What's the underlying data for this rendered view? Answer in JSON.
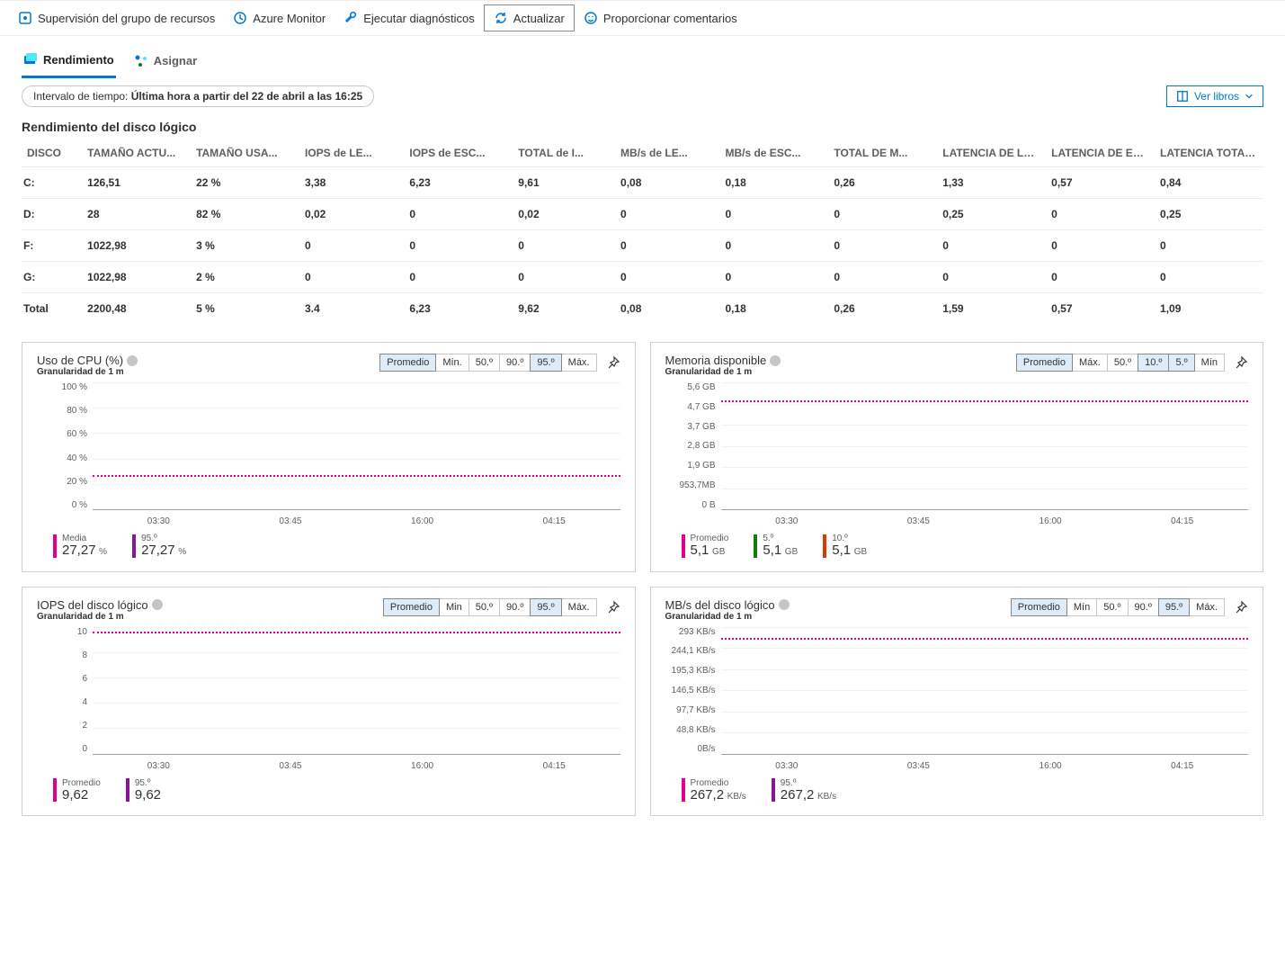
{
  "toolbar": {
    "resource_group": "Supervisión del grupo de recursos",
    "monitor": "Azure Monitor",
    "diagnostics": "Ejecutar diagnósticos",
    "refresh": "Actualizar",
    "feedback": "Proporcionar comentarios"
  },
  "tabs": {
    "performance": "Rendimiento",
    "assign": "Asignar"
  },
  "timerange": {
    "prefix": "Intervalo de tiempo: ",
    "value": "Última hora a partir del 22 de abril a las 16:25"
  },
  "view_books": "Ver libros",
  "section": {
    "title": "Rendimiento del disco lógico"
  },
  "table": {
    "headers": [
      "DISCO",
      "TAMAÑO ACTU...",
      "TAMAÑO USA...",
      "IOPS de LE...",
      "IOPS de ESC...",
      "TOTAL de I...",
      "MB/s de LE...",
      "MB/s de ESC...",
      "TOTAL DE M...",
      "LATENCIA DE LECT...",
      "LATENCIA DE ESCRI...",
      "LATENCIA TOTAL de..."
    ],
    "rows": [
      [
        "C:",
        "126,51",
        "22 %",
        "3,38",
        "6,23",
        "9,61",
        "0,08",
        "0,18",
        "0,26",
        "1,33",
        "0,57",
        "0,84"
      ],
      [
        "D:",
        "28",
        "82 %",
        "0,02",
        "0",
        "0,02",
        "0",
        "0",
        "0",
        "0,25",
        "0",
        "0,25"
      ],
      [
        "F:",
        "1022,98",
        "3 %",
        "0",
        "0",
        "0",
        "0",
        "0",
        "0",
        "0",
        "0",
        "0"
      ],
      [
        "G:",
        "1022,98",
        "2 %",
        "0",
        "0",
        "0",
        "0",
        "0",
        "0",
        "0",
        "0",
        "0"
      ],
      [
        "Total",
        "2200,48",
        "5 %",
        "3.4",
        "6,23",
        "9,62",
        "0,08",
        "0,18",
        "0,26",
        "1,59",
        "0,57",
        "1,09"
      ]
    ]
  },
  "charts": {
    "cpu": {
      "title": "Uso de CPU (%)",
      "sub": "Granularidad de 1 m",
      "agg": [
        "Promedio",
        "Mín.",
        "50.º",
        "90.º",
        "95.º",
        "Máx."
      ],
      "agg_sel": [
        0,
        4
      ],
      "yticks": [
        "100 %",
        "80 %",
        "60 %",
        "40 %",
        "20 %",
        "0 %"
      ],
      "xticks": [
        "03:30",
        "03:45",
        "16:00",
        "04:15"
      ],
      "legend": [
        {
          "label": "Media",
          "value": "27,27",
          "unit": "%",
          "color": "pink"
        },
        {
          "label": "95.º",
          "value": "27,27",
          "unit": "%",
          "color": "purple"
        }
      ]
    },
    "mem": {
      "title": "Memoria disponible",
      "sub": "Granularidad de 1 m",
      "agg": [
        "Promedio",
        "Máx.",
        "50.º",
        "10.º",
        "5.º",
        "Mín"
      ],
      "agg_sel": [
        0,
        3,
        4
      ],
      "yticks": [
        "5,6 GB",
        "4,7 GB",
        "3,7 GB",
        "2,8 GB",
        "1,9 GB",
        "953,7MB",
        "0 B"
      ],
      "xticks": [
        "03:30",
        "03:45",
        "16:00",
        "04:15"
      ],
      "legend": [
        {
          "label": "Promedio",
          "value": "5,1",
          "unit": "GB",
          "color": "pink"
        },
        {
          "label": "5.º",
          "value": "5,1",
          "unit": "GB",
          "color": "green"
        },
        {
          "label": "10.º",
          "value": "5,1",
          "unit": "GB",
          "color": "orange"
        }
      ]
    },
    "iops": {
      "title": "IOPS del disco lógico",
      "sub": "Granularidad de 1 m",
      "agg": [
        "Promedio",
        "Min",
        "50.º",
        "90.º",
        "95.º",
        "Máx."
      ],
      "agg_sel": [
        0,
        4
      ],
      "yticks": [
        "10",
        "8",
        "6",
        "4",
        "2",
        "0"
      ],
      "xticks": [
        "03:30",
        "03:45",
        "16:00",
        "04:15"
      ],
      "legend": [
        {
          "label": "Promedio",
          "value": "9,62",
          "unit": "",
          "color": "pink"
        },
        {
          "label": "95.º",
          "value": "9,62",
          "unit": "",
          "color": "purple"
        }
      ]
    },
    "mbs": {
      "title": "MB/s del disco lógico",
      "sub": "Granularidad de 1 m",
      "agg": [
        "Promedio",
        "Mín",
        "50.º",
        "90.º",
        "95.º",
        "Máx."
      ],
      "agg_sel": [
        0,
        4
      ],
      "yticks": [
        "293 KB/s",
        "244,1 KB/s",
        "195,3 KB/s",
        "146,5 KB/s",
        "97,7 KB/s",
        "48,8 KB/s",
        "0B/s"
      ],
      "xticks": [
        "03:30",
        "03:45",
        "16:00",
        "04:15"
      ],
      "legend": [
        {
          "label": "Promedio",
          "value": "267,2",
          "unit": "KB/s",
          "color": "pink"
        },
        {
          "label": "95.º",
          "value": "267,2",
          "unit": "KB/s",
          "color": "purple"
        }
      ]
    }
  },
  "chart_data": [
    {
      "type": "line",
      "title": "Uso de CPU (%)",
      "x": [
        "03:30",
        "03:45",
        "16:00",
        "04:15"
      ],
      "series": [
        {
          "name": "Media",
          "values": [
            27.27,
            27.27,
            27.27,
            27.27
          ]
        },
        {
          "name": "95.º",
          "values": [
            27.27,
            27.27,
            27.27,
            27.27
          ]
        }
      ],
      "ylim": [
        0,
        100
      ],
      "ylabel": "%"
    },
    {
      "type": "line",
      "title": "Memoria disponible",
      "x": [
        "03:30",
        "03:45",
        "16:00",
        "04:15"
      ],
      "series": [
        {
          "name": "Promedio",
          "values": [
            5.1,
            5.1,
            5.1,
            5.1
          ]
        },
        {
          "name": "5.º",
          "values": [
            5.1,
            5.1,
            5.1,
            5.1
          ]
        },
        {
          "name": "10.º",
          "values": [
            5.1,
            5.1,
            5.1,
            5.1
          ]
        }
      ],
      "ylim": [
        0,
        5.6
      ],
      "ylabel": "GB"
    },
    {
      "type": "line",
      "title": "IOPS del disco lógico",
      "x": [
        "03:30",
        "03:45",
        "16:00",
        "04:15"
      ],
      "series": [
        {
          "name": "Promedio",
          "values": [
            9.62,
            9.62,
            9.62,
            9.62
          ]
        },
        {
          "name": "95.º",
          "values": [
            9.62,
            9.62,
            9.62,
            9.62
          ]
        }
      ],
      "ylim": [
        0,
        10
      ],
      "ylabel": "IOPS"
    },
    {
      "type": "line",
      "title": "MB/s del disco lógico",
      "x": [
        "03:30",
        "03:45",
        "16:00",
        "04:15"
      ],
      "series": [
        {
          "name": "Promedio",
          "values": [
            267.2,
            267.2,
            267.2,
            267.2
          ]
        },
        {
          "name": "95.º",
          "values": [
            267.2,
            267.2,
            267.2,
            267.2
          ]
        }
      ],
      "ylim": [
        0,
        293
      ],
      "ylabel": "KB/s"
    }
  ]
}
